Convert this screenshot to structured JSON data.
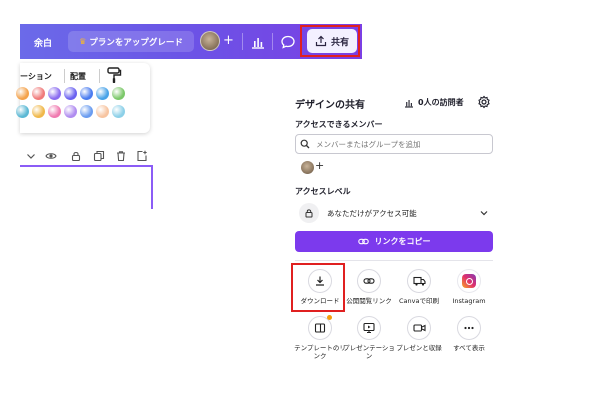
{
  "topbar": {
    "margin_label": "余白",
    "upgrade_label": "プランをアップグレード",
    "share_label": "共有"
  },
  "toolbar_card": {
    "animation_label": "ーション",
    "position_label": "配置",
    "swatch_colors": [
      "#f4a24b",
      "#f07a7a",
      "#8b6cf0",
      "#6b62f0",
      "#4a7cf0",
      "#49a3e8",
      "#7cc86a",
      "#5bb8d4",
      "#f0b84a",
      "#f07ab0",
      "#b08cf0",
      "#6a9cf0",
      "#f7c4a0",
      "#8cd0e8"
    ]
  },
  "share_panel": {
    "title": "デザインの共有",
    "visitors_label": "0人の訪問者",
    "access_members_label": "アクセスできるメンバー",
    "search_placeholder": "メンバーまたはグループを追加",
    "access_level_label": "アクセスレベル",
    "access_value": "あなただけがアクセス可能",
    "copy_link_label": "リンクをコピー",
    "options": [
      {
        "label": "ダウンロード",
        "icon": "download-icon"
      },
      {
        "label": "公開閲覧リンク",
        "icon": "link-icon"
      },
      {
        "label": "Canvaで印刷",
        "icon": "truck-icon"
      },
      {
        "label": "Instagram",
        "icon": "instagram-icon"
      },
      {
        "label": "テンプレートのリンク",
        "icon": "template-icon"
      },
      {
        "label": "プレゼンテーション",
        "icon": "presentation-icon"
      },
      {
        "label": "プレゼンと収録",
        "icon": "record-icon"
      },
      {
        "label": "すべて表示",
        "icon": "more-icon"
      }
    ]
  },
  "colors": {
    "accent": "#7c3aed",
    "highlight": "#e02020"
  }
}
